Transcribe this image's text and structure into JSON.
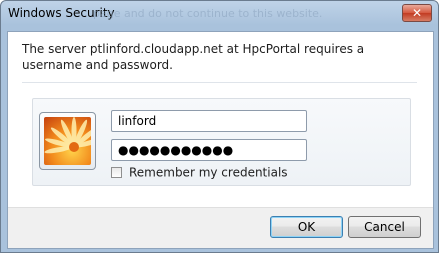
{
  "window": {
    "title": "Windows Security",
    "ghost_text": "page and do not continue to this website.",
    "close_glyph": "✕"
  },
  "message": "The server ptlinford.cloudapp.net at HpcPortal requires a username and password.",
  "credentials": {
    "username": "linford",
    "password_mask": "●●●●●●●●●●●",
    "remember_label": "Remember my credentials",
    "remember_checked": false,
    "tile_icon": "flower-user-tile-icon"
  },
  "buttons": {
    "ok": "OK",
    "cancel": "Cancel"
  },
  "colors": {
    "title_bar": "#a9c2dc",
    "ok_focus": "#3c7fb1"
  }
}
